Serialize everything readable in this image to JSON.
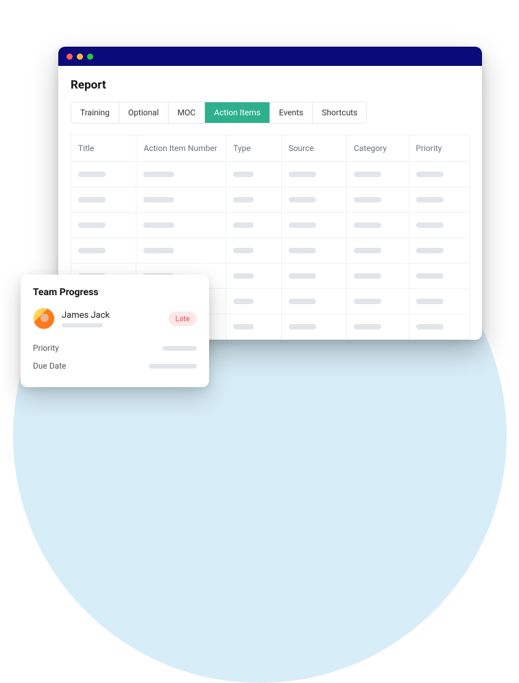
{
  "page": {
    "title": "Report"
  },
  "tabs": [
    {
      "label": "Training",
      "active": false
    },
    {
      "label": "Optional",
      "active": false
    },
    {
      "label": "MOC",
      "active": false
    },
    {
      "label": "Action Items",
      "active": true
    },
    {
      "label": "Events",
      "active": false
    },
    {
      "label": "Shortcuts",
      "active": false
    }
  ],
  "table": {
    "columns": [
      "Title",
      "Action Item Number",
      "Type",
      "Source",
      "Category",
      "Priority"
    ],
    "rows": 7
  },
  "teamProgress": {
    "title": "Team Progress",
    "member": {
      "name": "James Jack",
      "status": "Late"
    },
    "fields": [
      {
        "label": "Priority"
      },
      {
        "label": "Due Date"
      }
    ]
  }
}
